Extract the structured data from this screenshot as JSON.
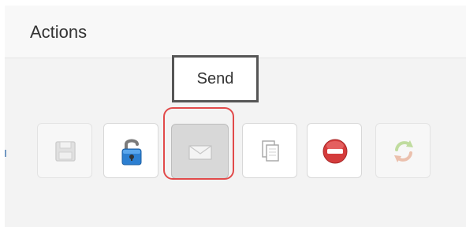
{
  "panel": {
    "title": "Actions"
  },
  "tooltip": {
    "text": "Send"
  },
  "toolbar": {
    "buttons": [
      {
        "name": "save",
        "icon": "save-icon",
        "enabled": false
      },
      {
        "name": "unlock",
        "icon": "unlock-icon",
        "enabled": true
      },
      {
        "name": "send",
        "icon": "envelope-icon",
        "enabled": true,
        "highlighted": true
      },
      {
        "name": "copy",
        "icon": "copy-icon",
        "enabled": true
      },
      {
        "name": "cancel",
        "icon": "stop-icon",
        "enabled": true
      },
      {
        "name": "refresh",
        "icon": "refresh-icon",
        "enabled": false
      }
    ]
  },
  "colors": {
    "highlight": "#e14a4a",
    "stop": "#d43c3c",
    "refresh_orange": "#e08b66",
    "refresh_green": "#8bc34a",
    "lock_blue": "#2c7fd1"
  }
}
